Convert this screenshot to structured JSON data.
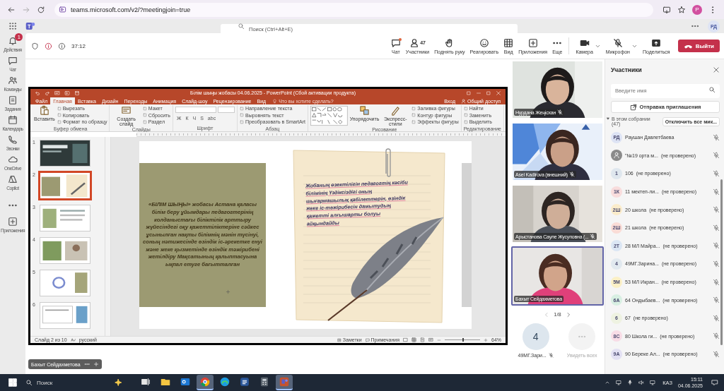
{
  "browser": {
    "url": "teams.microsoft.com/v2/?meetingjoin=true",
    "profile": "P"
  },
  "teams_header": {
    "search": {
      "placeholder": "Поиск (Ctrl+Alt+E)"
    },
    "avatar": "РД"
  },
  "rail": [
    {
      "kind": "bell",
      "label": "Действия",
      "badge": "1"
    },
    {
      "kind": "chat",
      "label": "Чат"
    },
    {
      "kind": "teams",
      "label": "Команды"
    },
    {
      "kind": "tasks",
      "label": "Задания"
    },
    {
      "kind": "calendar",
      "label": "Календарь"
    },
    {
      "kind": "phone",
      "label": "Звонки"
    },
    {
      "kind": "cloud",
      "label": "OneDrive"
    },
    {
      "kind": "copilot",
      "label": "Copilot"
    },
    {
      "kind": "more"
    },
    {
      "kind": "plus",
      "label": "Приложения"
    }
  ],
  "meeting": {
    "timer": "37:12",
    "tools": [
      {
        "kind": "chat",
        "label": "Чат",
        "dot": true
      },
      {
        "kind": "people",
        "label": "Участники",
        "count": "47"
      },
      {
        "kind": "hand",
        "label": "Поднять руку"
      },
      {
        "kind": "smile",
        "label": "Реагировать"
      },
      {
        "kind": "grid",
        "label": "Вид"
      },
      {
        "kind": "apps",
        "label": "Приложения"
      },
      {
        "kind": "more",
        "label": "Еще"
      }
    ],
    "devices": [
      {
        "kind": "camera",
        "label": "Камера",
        "dropdown": true
      },
      {
        "kind": "micoff",
        "label": "Микрофон",
        "dropdown": true
      },
      {
        "kind": "share",
        "label": "Поделиться",
        "dropdown": false
      }
    ],
    "leave_button": "Выйти"
  },
  "shared_screen": {
    "presenter": "Бахыт Сейдахметова"
  },
  "powerpoint": {
    "title": "Білім шыңы жобасы 04.06.2025 - PowerPoint (Сбой активации продукта)",
    "tabs": [
      {
        "label": "Файл",
        "selected": false
      },
      {
        "label": "Главная",
        "selected": true
      },
      {
        "label": "Вставка",
        "selected": false
      },
      {
        "label": "Дизайн",
        "selected": false
      },
      {
        "label": "Переходы",
        "selected": false
      },
      {
        "label": "Анимация",
        "selected": false
      },
      {
        "label": "Слайд-шоу",
        "selected": false
      },
      {
        "label": "Рецензирование",
        "selected": false
      },
      {
        "label": "Вид",
        "selected": false
      }
    ],
    "tell_me": "Что вы хотите сделать?",
    "sign_in": "Вход",
    "share": "Общий доступ",
    "groups": [
      {
        "kind": "buttons",
        "name": "Буфер обмена",
        "buttons": [
          "Вставить"
        ],
        "items": [
          "Вырезать",
          "Копировать",
          "Формат по образцу"
        ]
      },
      {
        "kind": "buttons",
        "name": "Слайды",
        "buttons": [
          "Создать слайд"
        ],
        "items": [
          "Макет",
          "Сбросить",
          "Раздел"
        ]
      },
      {
        "kind": "font",
        "name": "Шрифт",
        "keys": [
          "Ж",
          "К",
          "Ч",
          "S",
          "abc"
        ]
      },
      {
        "kind": "buttons",
        "name": "Абзац",
        "items": [
          "Направление текста",
          "Выровнять текст",
          "Преобразовать в SmartArt"
        ]
      },
      {
        "kind": "shapes",
        "name": "Рисование",
        "buttons": [
          "Упорядочить",
          "Экспресс-стили"
        ],
        "items": [
          "Заливка фигуры",
          "Контур фигуры",
          "Эффекты фигуры"
        ]
      },
      {
        "kind": "buttons",
        "name": "Редактирование",
        "items": [
          "Найти",
          "Заменить",
          "Выделить"
        ]
      }
    ],
    "thumbnails": [
      {
        "number": "1",
        "selected": false
      },
      {
        "number": "2",
        "selected": true
      },
      {
        "number": "3",
        "selected": false
      },
      {
        "number": "4",
        "selected": false
      },
      {
        "number": "5",
        "selected": false
      },
      {
        "number": "6",
        "selected": false
      }
    ],
    "slide": {
      "panel_text": "«БІЛІМ ШЫҢЫ» жобасы Астана қаласы білім беру ұйымдары педагогтерінің колданыстағы біліктілік арттыру жүйесіндегі оқу қажеттіліктеріне сәйкес ұсынылған нақты білімнің мәнін түсінуі, соның нәтижесінде өзіндік іс-әрекетке енуі және жеке қызметінде өзіндік тәжірибені жетілдіру Мақсатының қалыптасуына ықпал етуге бағытталған",
      "note_text": "Жобаның өзектілігін педагогтің кәсіби білімінің Үздіксіздігі оның шығармашылық қабілеттерін, өзіндік жеке іс-тәжірибесін дамытудың қажетті алғышарты болуы айқындайды"
    },
    "status_bar": {
      "slide_info": "Слайд 2 из 10",
      "language": "русский",
      "notes": "Заметки",
      "comments": "Примечания",
      "zoom": "64%",
      "zoom_slider": {
        "level": 0.5
      }
    }
  },
  "videos": {
    "tiles": [
      {
        "name": "Нурдана Жеңісхан",
        "mic": true,
        "selected": false
      },
      {
        "name": "Asel Kadirova (внешний)",
        "mic": true,
        "selected": false
      },
      {
        "name": "Арыстанова Сауле Жусуповна (...",
        "mic": true,
        "selected": false
      },
      {
        "name": "Бахыт Сейдахметова",
        "mic": false,
        "selected": true
      }
    ],
    "pager": "1/8",
    "extra": [
      {
        "kind": "avatar",
        "initials": "4",
        "name": "49МГ.Зари..."
      },
      {
        "kind": "more",
        "name": "Увидеть всех"
      }
    ]
  },
  "participants_panel": {
    "title": "Участники",
    "search": {
      "placeholder": "Введите имя"
    },
    "invite_button": "Отправка приглашения",
    "section": {
      "label": "В этом собрании",
      "count": "(47)",
      "expanded": true
    },
    "mute_all_button": "Отключить все мик...",
    "people": [
      {
        "kind": "initials",
        "initials": "РД",
        "name": "Раушан Давлетбаева",
        "color": "#dde3f4",
        "muted": true
      },
      {
        "kind": "generic",
        "name": "\"№19 орта м...",
        "status": "(не проверено)",
        "color": "#8a8a8a",
        "muted": true
      },
      {
        "kind": "initials",
        "initials": "1",
        "name": "106",
        "status": "(не проверено)",
        "color": "#dfe7ee",
        "muted": true
      },
      {
        "kind": "initials",
        "initials": "1К",
        "name": "11 мектеп-ли...",
        "status": "(не проверено)",
        "color": "#f8dcdc",
        "muted": true
      },
      {
        "kind": "initials",
        "initials": "2Ш",
        "name": "20 школа",
        "status": "(не проверено)",
        "color": "#fbeccb",
        "muted": true
      },
      {
        "kind": "initials",
        "initials": "2Ш",
        "name": "21 школа",
        "status": "(не проверено)",
        "color": "#fadcd6",
        "muted": true
      },
      {
        "kind": "initials",
        "initials": "2Т",
        "name": "28 МЛ Майра...",
        "status": "(не проверено)",
        "color": "#dbe6f4",
        "muted": true
      },
      {
        "kind": "initials",
        "initials": "4",
        "name": "49МГ.Зарина...",
        "status": "(не проверено)",
        "color": "#e1e9ef",
        "muted": true
      },
      {
        "kind": "initials",
        "initials": "5М",
        "name": "53 МЛ Икран...",
        "status": "(не проверено)",
        "color": "#fbf0c6",
        "muted": true
      },
      {
        "kind": "initials",
        "initials": "6А",
        "name": "64 Ондыбаев...",
        "status": "(не проверено)",
        "color": "#d8efe2",
        "muted": true
      },
      {
        "kind": "initials",
        "initials": "6",
        "name": "67",
        "status": "(не проверено)",
        "color": "#eef2e1",
        "muted": true
      },
      {
        "kind": "initials",
        "initials": "8С",
        "name": "80 Школа ги...",
        "status": "(не проверено)",
        "color": "#f8dce6",
        "muted": true
      },
      {
        "kind": "initials",
        "initials": "9А",
        "name": "90 Береке Ал...",
        "status": "(не проверено)",
        "color": "#e2e0f3",
        "muted": true
      }
    ]
  },
  "taskbar": {
    "search": "Поиск",
    "apps": [
      {
        "kind": "taskview",
        "selected": false
      },
      {
        "kind": "folder",
        "selected": false
      },
      {
        "kind": "mail",
        "selected": false
      },
      {
        "kind": "chrome",
        "selected": true
      },
      {
        "kind": "edge",
        "selected": false
      },
      {
        "kind": "word",
        "selected": false
      },
      {
        "kind": "calc",
        "selected": false
      },
      {
        "kind": "teams",
        "selected": true
      }
    ],
    "language": "КАЗ",
    "time": "15:11",
    "date": "04.06.2025"
  }
}
